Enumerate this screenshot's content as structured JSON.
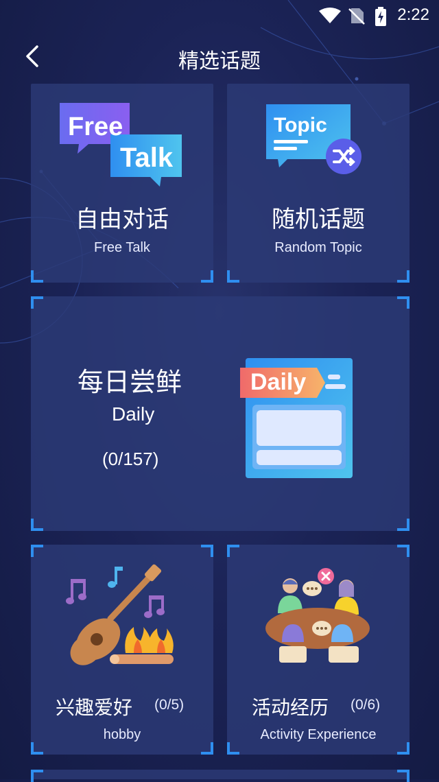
{
  "status_bar": {
    "time": "2:22",
    "icons": [
      "wifi-icon",
      "no-sim-icon",
      "battery-charging-icon"
    ]
  },
  "header": {
    "title": "精选话题",
    "back_icon": "chevron-left-icon"
  },
  "cards": {
    "free_talk": {
      "title": "自由对话",
      "subtitle": "Free Talk",
      "badge_line1": "Free",
      "badge_line2": "Talk"
    },
    "random_topic": {
      "title": "随机话题",
      "subtitle": "Random Topic",
      "badge": "Topic"
    },
    "daily": {
      "title": "每日尝鲜",
      "subtitle": "Daily",
      "count": "(0/157)",
      "badge": "Daily"
    },
    "hobby": {
      "title": "兴趣爱好",
      "subtitle": "hobby",
      "count": "(0/5)"
    },
    "activity": {
      "title": "活动经历",
      "subtitle": "Activity Experience",
      "count": "(0/6)"
    }
  },
  "colors": {
    "accent": "#2f8ff0",
    "card_bg": "#2c3a76",
    "page_bg": "#1b2356"
  }
}
